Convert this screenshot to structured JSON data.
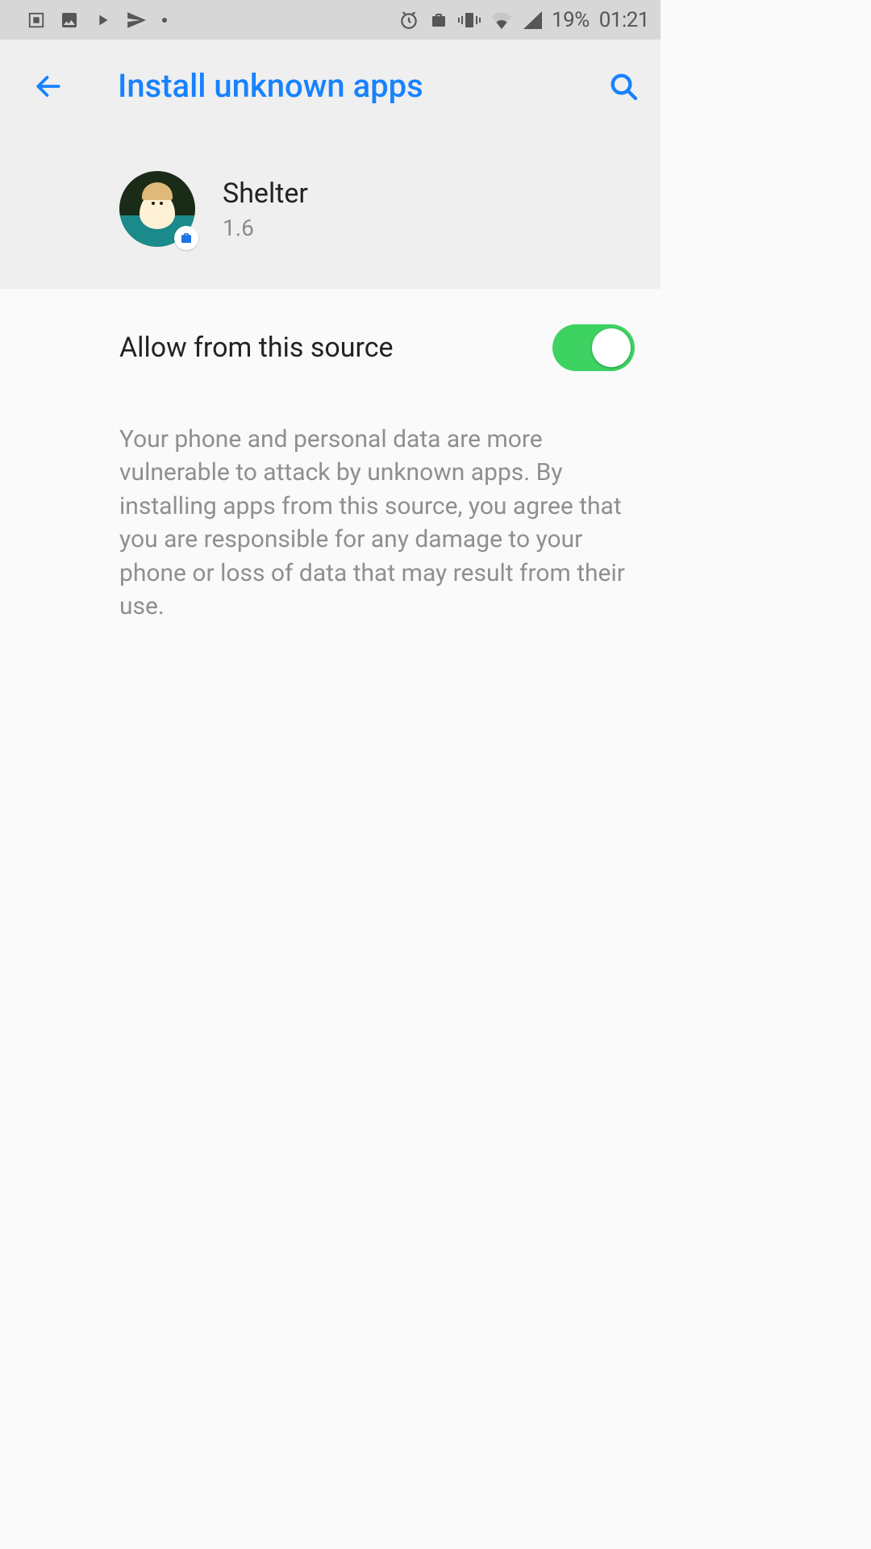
{
  "statusbar": {
    "battery": "19%",
    "clock": "01:21"
  },
  "header": {
    "title": "Install unknown apps"
  },
  "app": {
    "name": "Shelter",
    "version": "1.6"
  },
  "toggle": {
    "label": "Allow from this source",
    "on": true
  },
  "warning": "Your phone and personal data are more vulnerable to attack by unknown apps. By installing apps from this source, you agree that you are responsible for any damage to your phone or loss of data that may result from their use."
}
